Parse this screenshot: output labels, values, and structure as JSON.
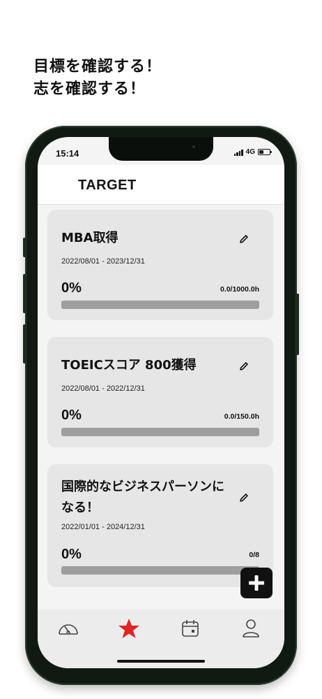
{
  "headline": {
    "line1": "目標を確認する！",
    "line2": "志を確認する！"
  },
  "status_bar": {
    "time": "15:14",
    "network": "4G"
  },
  "app_bar": {
    "title": "TARGET"
  },
  "goals": [
    {
      "title": "MBA取得",
      "dates": "2022/08/01 - 2023/12/31",
      "percent_label": "0%",
      "progress_fraction": 0,
      "hours": "0.0/1000.0h"
    },
    {
      "title": "TOEICスコア 800獲得",
      "dates": "2022/08/01 - 2022/12/31",
      "percent_label": "0%",
      "progress_fraction": 0,
      "hours": "0.0/150.0h"
    },
    {
      "title": "国際的なビジネスパーソンになる！",
      "dates": "2022/01/01 - 2024/12/31",
      "percent_label": "0%",
      "progress_fraction": 0,
      "hours": "0/8"
    }
  ],
  "icons": {
    "edit": "pencil-icon",
    "fab": "plus-icon",
    "tab_dashboard": "gauge-icon",
    "tab_target": "star-icon",
    "tab_calendar": "calendar-icon",
    "tab_profile": "person-icon"
  },
  "colors": {
    "active_tab": "#e02424",
    "card_bg": "#e6e6e6",
    "progress_track": "#9e9e9e",
    "fab_bg": "#111111"
  }
}
